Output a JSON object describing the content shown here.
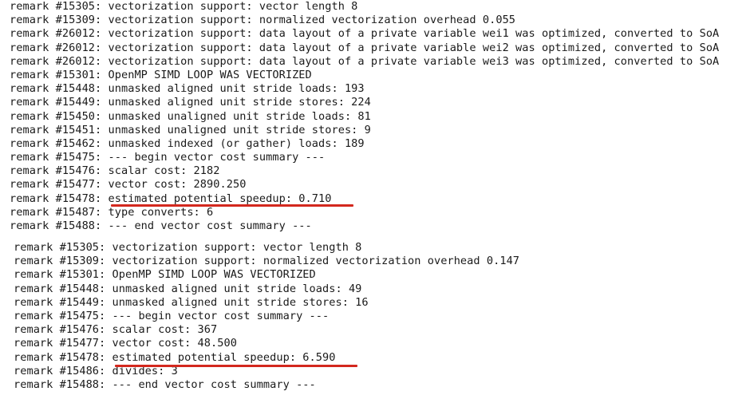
{
  "highlight_color": "#d3281e",
  "blocks": [
    {
      "lines": [
        {
          "code": "remark #15305:",
          "message": "vectorization support: vector length 8"
        },
        {
          "code": "remark #15309:",
          "message": "vectorization support: normalized vectorization overhead 0.055"
        },
        {
          "code": "remark #26012:",
          "message": "vectorization support: data layout of a private variable wei1 was optimized, converted to SoA"
        },
        {
          "code": "remark #26012:",
          "message": "vectorization support: data layout of a private variable wei2 was optimized, converted to SoA"
        },
        {
          "code": "remark #26012:",
          "message": "vectorization support: data layout of a private variable wei3 was optimized, converted to SoA"
        },
        {
          "code": "remark #15301:",
          "message": "OpenMP SIMD LOOP WAS VECTORIZED"
        },
        {
          "code": "remark #15448:",
          "message": "unmasked aligned unit stride loads: 193"
        },
        {
          "code": "remark #15449:",
          "message": "unmasked aligned unit stride stores: 224"
        },
        {
          "code": "remark #15450:",
          "message": "unmasked unaligned unit stride loads: 81"
        },
        {
          "code": "remark #15451:",
          "message": "unmasked unaligned unit stride stores: 9"
        },
        {
          "code": "remark #15462:",
          "message": "unmasked indexed (or gather) loads: 189"
        },
        {
          "code": "remark #15475:",
          "message": "--- begin vector cost summary ---"
        },
        {
          "code": "remark #15476:",
          "message": "scalar cost: 2182"
        },
        {
          "code": "remark #15477:",
          "message": "vector cost: 2890.250"
        },
        {
          "code": "remark #15478:",
          "message": "estimated potential speedup: 0.710",
          "highlighted": true
        },
        {
          "code": "remark #15487:",
          "message": "type converts: 6"
        },
        {
          "code": "remark #15488:",
          "message": "--- end vector cost summary ---"
        }
      ]
    },
    {
      "lines": [
        {
          "code": "remark #15305:",
          "message": "vectorization support: vector length 8"
        },
        {
          "code": "remark #15309:",
          "message": "vectorization support: normalized vectorization overhead 0.147"
        },
        {
          "code": "remark #15301:",
          "message": "OpenMP SIMD LOOP WAS VECTORIZED"
        },
        {
          "code": "remark #15448:",
          "message": "unmasked aligned unit stride loads: 49"
        },
        {
          "code": "remark #15449:",
          "message": "unmasked aligned unit stride stores: 16"
        },
        {
          "code": "remark #15475:",
          "message": "--- begin vector cost summary ---"
        },
        {
          "code": "remark #15476:",
          "message": "scalar cost: 367"
        },
        {
          "code": "remark #15477:",
          "message": "vector cost: 48.500"
        },
        {
          "code": "remark #15478:",
          "message": "estimated potential speedup: 6.590",
          "highlighted": true
        },
        {
          "code": "remark #15486:",
          "message": "divides: 3"
        },
        {
          "code": "remark #15488:",
          "message": "--- end vector cost summary ---"
        }
      ]
    }
  ]
}
